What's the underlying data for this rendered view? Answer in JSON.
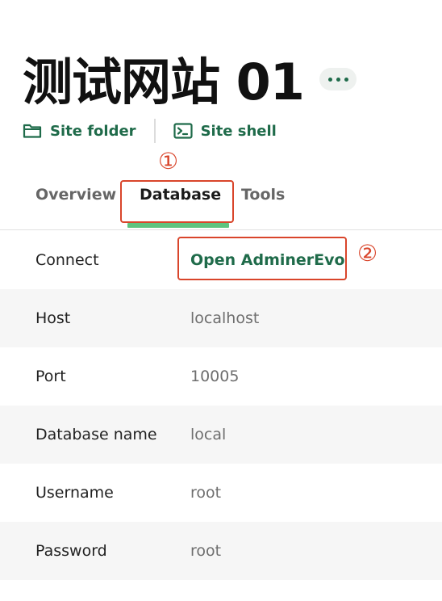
{
  "header": {
    "title": "测试网站 01",
    "more_button": "more-options"
  },
  "links": {
    "site_folder": "Site folder",
    "site_shell": "Site shell"
  },
  "annotations": {
    "marker_1": "①",
    "marker_2": "②"
  },
  "tabs": [
    {
      "label": "Overview",
      "active": false
    },
    {
      "label": "Database",
      "active": true
    },
    {
      "label": "Tools",
      "active": false
    }
  ],
  "database": {
    "rows": [
      {
        "label": "Connect",
        "value": "Open AdminerEvo"
      },
      {
        "label": "Host",
        "value": "localhost"
      },
      {
        "label": "Port",
        "value": "10005"
      },
      {
        "label": "Database name",
        "value": "local"
      },
      {
        "label": "Username",
        "value": "root"
      },
      {
        "label": "Password",
        "value": "root"
      }
    ]
  },
  "colors": {
    "accent": "#1f6b4a",
    "active_tab_underline": "#5ec47f",
    "annotation": "#d9452b"
  }
}
